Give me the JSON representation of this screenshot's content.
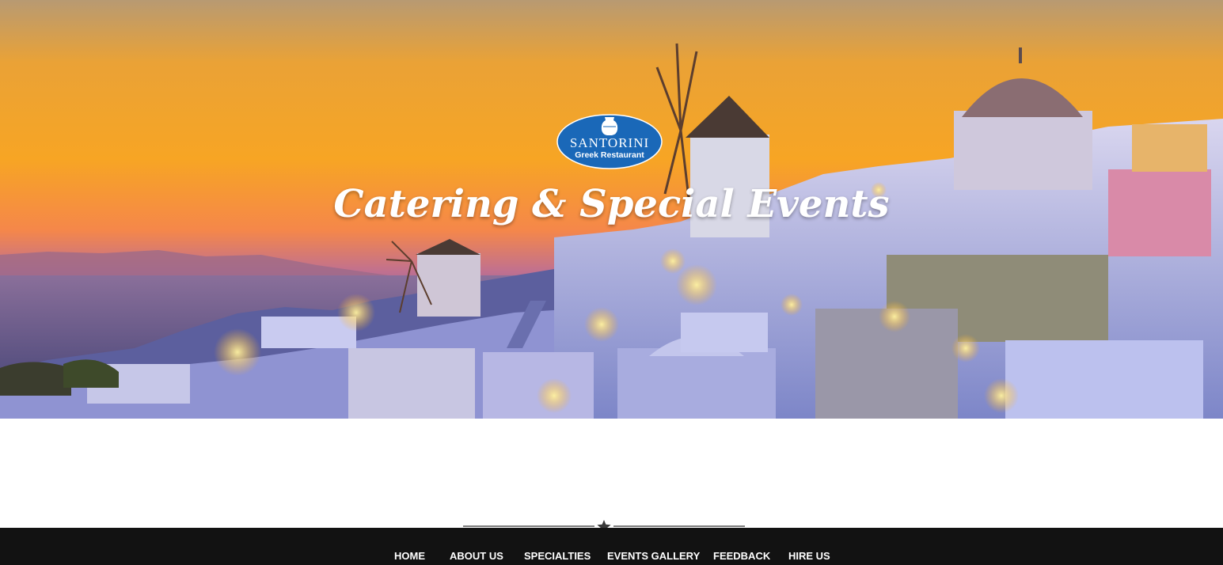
{
  "logo": {
    "title": "SANTORINI",
    "subtitle": "Greek Restaurant"
  },
  "hero": {
    "heading": "Catering & Special Events"
  },
  "nav": {
    "items": [
      {
        "label": "HOME"
      },
      {
        "label": "ABOUT US"
      },
      {
        "label": "SPECIALTIES"
      },
      {
        "label": "EVENTS GALLERY"
      },
      {
        "label": "FEEDBACK"
      },
      {
        "label": "HIRE US"
      }
    ]
  },
  "colors": {
    "logo_blue": "#1a68b8",
    "nav_background": "#121212",
    "nav_text": "#ffffff",
    "sky_orange": "#f7a022"
  }
}
